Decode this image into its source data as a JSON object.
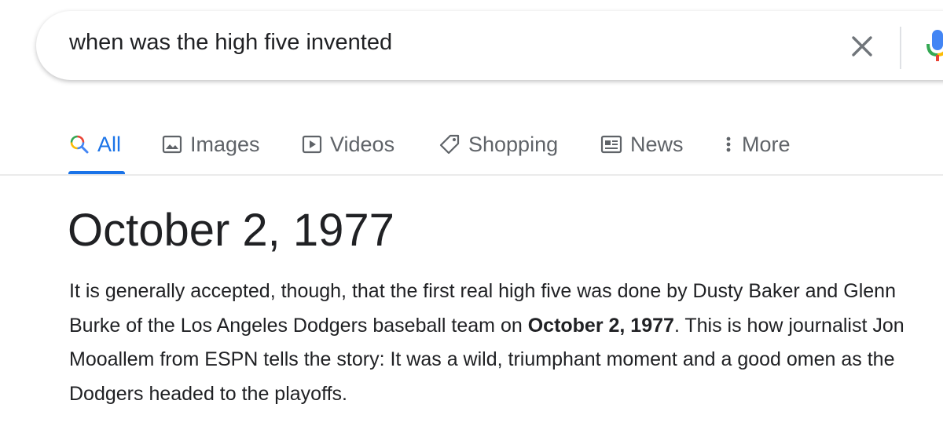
{
  "search": {
    "query": "when was the high five invented",
    "icons": {
      "clear": "close-icon",
      "voice": "microphone-icon"
    }
  },
  "tabs": [
    {
      "label": "All",
      "icon": "search-icon",
      "active": true
    },
    {
      "label": "Images",
      "icon": "image-icon",
      "active": false
    },
    {
      "label": "Videos",
      "icon": "play-icon",
      "active": false
    },
    {
      "label": "Shopping",
      "icon": "tag-icon",
      "active": false
    },
    {
      "label": "News",
      "icon": "newspaper-icon",
      "active": false
    },
    {
      "label": "More",
      "icon": "more-vert-icon",
      "active": false
    }
  ],
  "answer": {
    "title": "October 2, 1977",
    "snippet_before": "It is generally accepted, though, that the first real high five was done by Dusty Baker and Glenn Burke of the Los Angeles Dodgers baseball team on ",
    "snippet_bold": "October 2, 1977",
    "snippet_after": ". This is how journalist Jon Mooallem from ESPN tells the story: It was a wild, triumphant moment and a good omen as the Dodgers headed to the playoffs."
  },
  "colors": {
    "accent": "#1a73e8",
    "text": "#202124",
    "muted": "#5f6368",
    "divider": "#ebebeb"
  }
}
